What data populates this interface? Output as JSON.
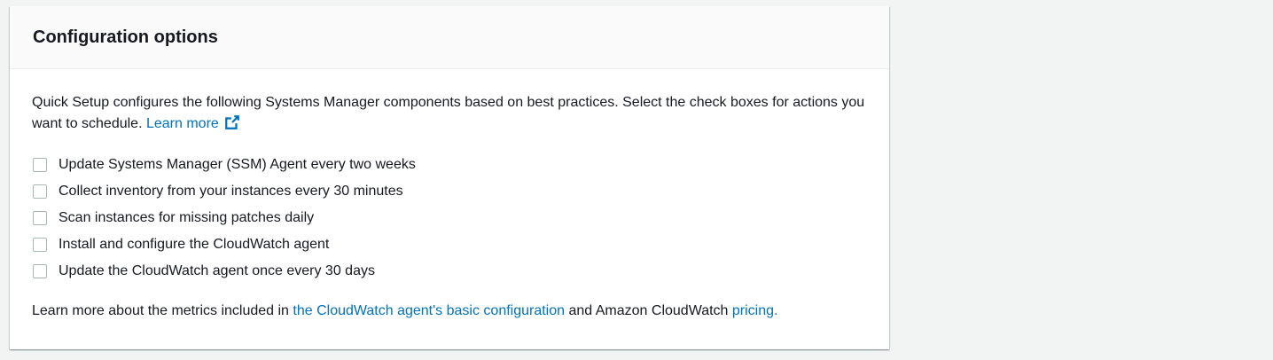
{
  "panel": {
    "title": "Configuration options",
    "intro_text": "Quick Setup configures the following Systems Manager components based on best practices. Select the check boxes for actions you want to schedule.",
    "learn_more_label": "Learn more",
    "options": [
      {
        "label": "Update Systems Manager (SSM) Agent every two weeks",
        "checked": false
      },
      {
        "label": "Collect inventory from your instances every 30 minutes",
        "checked": false
      },
      {
        "label": "Scan instances for missing patches daily",
        "checked": false
      },
      {
        "label": "Install and configure the CloudWatch agent",
        "checked": false
      },
      {
        "label": "Update the CloudWatch agent once every 30 days",
        "checked": false
      }
    ],
    "footer": {
      "prefix": "Learn more about the metrics included in",
      "config_link": "the CloudWatch agent's basic configuration",
      "middle": "and Amazon CloudWatch",
      "pricing_link": "pricing."
    }
  },
  "colors": {
    "link": "#0073bb",
    "text": "#16191f",
    "header_bg": "#fafafa",
    "page_bg": "#f2f3f3",
    "checkbox_border": "#aab7b8"
  },
  "icons": {
    "external_link": "external-link-icon"
  }
}
